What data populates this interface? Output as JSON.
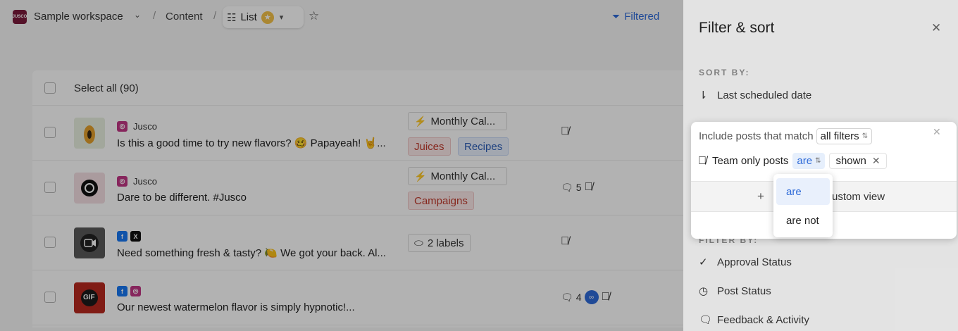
{
  "topbar": {
    "workspace_logo": "JUSCO",
    "workspace_name": "Sample workspace",
    "crumb": "Content",
    "separator": "/",
    "view_name": "List",
    "filtered_label": "Filtered"
  },
  "list": {
    "select_all": "Select all (90)",
    "rows": [
      {
        "account": "Jusco",
        "caption": "Is this a good time to try new flavors? 🥴 Papayeah! 🤘...",
        "tags": [
          "Monthly Cal...",
          "Juices",
          "Recipes"
        ]
      },
      {
        "account": "Jusco",
        "caption": "Dare to be different. #Jusco",
        "tags": [
          "Monthly Cal...",
          "Campaigns"
        ],
        "comments": "5"
      },
      {
        "account": "",
        "caption": "Need something fresh & tasty? 🍋 We got your back. Al...",
        "tags": [
          "2 labels"
        ]
      },
      {
        "account": "",
        "caption": "Our newest watermelon flavor is simply hypnotic!...",
        "tags": [],
        "comments": "4",
        "thumb_label": "GIF"
      }
    ]
  },
  "panel": {
    "title": "Filter & sort",
    "sort_label": "SORT BY:",
    "sort_value": "Last scheduled date",
    "filter_label": "FILTER BY:",
    "filters": [
      "Approval Status",
      "Post Status",
      "Feedback & Activity"
    ]
  },
  "popup": {
    "match_prefix": "Include posts that match",
    "match_value": "all filters",
    "condition_label": "Team only posts",
    "operator": "are",
    "value": "shown",
    "custom_view_label": "ustom view",
    "dropdown_options": [
      "are",
      "are not"
    ]
  }
}
